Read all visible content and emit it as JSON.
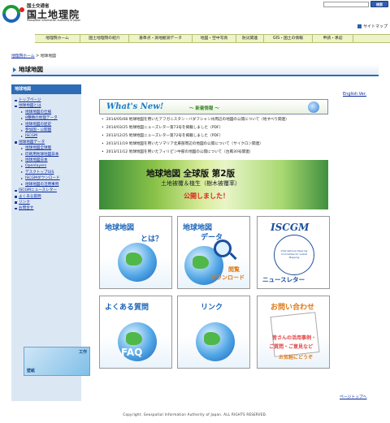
{
  "header": {
    "agency_line": "国土交通省",
    "org_name": "国土地理院",
    "org_name_en": "Geospatial Information Authority of Japan",
    "search_button": "検索",
    "sitemap": "サイトマップ"
  },
  "global_nav": [
    "地理院ホーム",
    "国土地理院の紹介",
    "基準点・測地観測データ",
    "地図・空中写真",
    "防災関連",
    "GIS・国土の情報",
    "申請・承認"
  ],
  "breadcrumb": {
    "home": "地理院ホーム",
    "sep": ">",
    "current": "地球地図"
  },
  "page_title": "地球地図",
  "sidebar": {
    "heading": "地球地図",
    "items": [
      {
        "label": "トップページ",
        "sub": false
      },
      {
        "label": "地球地図とは",
        "sub": false
      },
      {
        "label": "地球地図の仕様",
        "sub": true
      },
      {
        "label": "8種類の地理データ",
        "sub": true
      },
      {
        "label": "地球地図の歴史",
        "sub": true
      },
      {
        "label": "参加国・公開国",
        "sub": true
      },
      {
        "label": "ISCGM",
        "sub": true
      },
      {
        "label": "地球地図データ",
        "sub": false
      },
      {
        "label": "地球地図全球版",
        "sub": true
      },
      {
        "label": "印刷用地球地図日本",
        "sub": true
      },
      {
        "label": "地球地図日本",
        "sub": true
      },
      {
        "label": "Openlayers",
        "sub": true
      },
      {
        "label": "デスクトップGIS",
        "sub": true
      },
      {
        "label": "ISCGMダウンロード",
        "sub": true
      },
      {
        "label": "地球地図の活用事例",
        "sub": true
      },
      {
        "label": "ISCGMニュースレター",
        "sub": false
      },
      {
        "label": "よくある質問",
        "sub": false
      },
      {
        "label": "リンク",
        "sub": false
      },
      {
        "label": "お問合せ",
        "sub": false
      }
    ],
    "banner_top": "工作",
    "banner_bottom": "壁紙"
  },
  "english_link": "English Ver.",
  "news": {
    "title_en": "What's New!",
    "title_ja": "～ 新着情報 ～",
    "items": [
      "2014/05/08 地球地図を用いたアフガニスタン・バダフシャン州周辺の地図の公開について（地すべり関連）",
      "2014/03/25 地球地図ニューズレター第73号を掲載しました（PDF）",
      "2013/12/25 地球地図ニューズレター第72号を掲載しました（PDF）",
      "2013/11/19 地球地図を用いたソマリア北東部周辺の地図の公開について（サイクロン関連）",
      "2013/11/12 地球地図を用いたフィリピン中部の地図の公開について（台風30号関連）"
    ]
  },
  "hero": {
    "line1": "地球地図 全球版 第2版",
    "line2": "土地被覆＆植生（樹木被覆率）",
    "line3": "公開しました！"
  },
  "tiles": {
    "about": {
      "l1": "地球地図",
      "l2": "とは？"
    },
    "data": {
      "l1": "地球地図",
      "l2": "データ",
      "l3": "閲覧",
      "l4": "ダウンロード"
    },
    "iscgm": {
      "l1": "ISCGM",
      "ring": "International Steering Committee for Global Mapping",
      "l2": "ニュースレター"
    },
    "faq": {
      "l1": "よくある質問",
      "l2": "FAQ"
    },
    "link": {
      "l1": "リンク"
    },
    "inquiry": {
      "l1": "お問い合わせ",
      "l2": "皆さんの活用事例・",
      "l3": "ご質問・ご意見など",
      "l4": "お気軽にどうぞ"
    }
  },
  "to_top": "ページトップへ",
  "footer": "Copyright. Geospatial Information Authority of Japan. ALL RIGHTS RESERVED."
}
